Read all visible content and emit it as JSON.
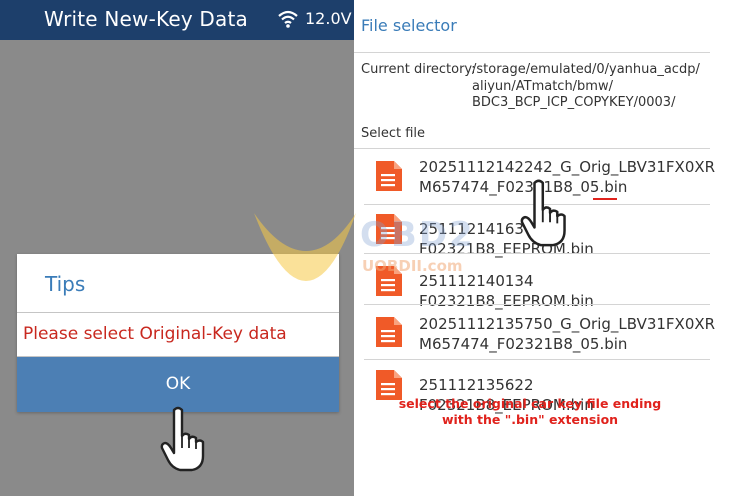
{
  "left_screen": {
    "title": "Write New-Key Data",
    "voltage": "12.0V",
    "status_icon": "wifi-icon",
    "dialog": {
      "title": "Tips",
      "message": "Please select Original-Key data",
      "ok_label": "OK"
    }
  },
  "right_screen": {
    "title": "File selector",
    "current_dir_label": "Current directory:",
    "current_dir_lines": [
      "/storage/emulated/0/yanhua_acdp/",
      "aliyun/ATmatch/bmw/",
      "BDC3_BCP_ICP_COPYKEY/0003/"
    ],
    "select_file_label": "Select file",
    "files": [
      {
        "line1": "20251112142242_G_Orig_LBV31FX0XR",
        "line2": "M657474_F02321B8_05.bin"
      },
      {
        "line1": "251112141637 F02321B8_EEPROM.bin",
        "line2": ""
      },
      {
        "line1": "251112140134 F02321B8_EEPROM.bin",
        "line2": ""
      },
      {
        "line1": "20251112135750_G_Orig_LBV31FX0XR",
        "line2": "M657474_F02321B8_05.bin"
      },
      {
        "line1": "251112135622 F02321B8_EEPROM.bin",
        "line2": ""
      }
    ]
  },
  "annotation": {
    "line1": "select the original car key file ending",
    "line2": "with the \".bin\" extension",
    "color": "#e0221c"
  },
  "watermark": {
    "brand": "OBD2",
    "url": "UOBDII.com"
  },
  "colors": {
    "header": "#1d3f6b",
    "accent": "#3a7cb8",
    "ok_button": "#4c7fb4",
    "error_text": "#c8281f",
    "file_icon": "#f05a28"
  }
}
